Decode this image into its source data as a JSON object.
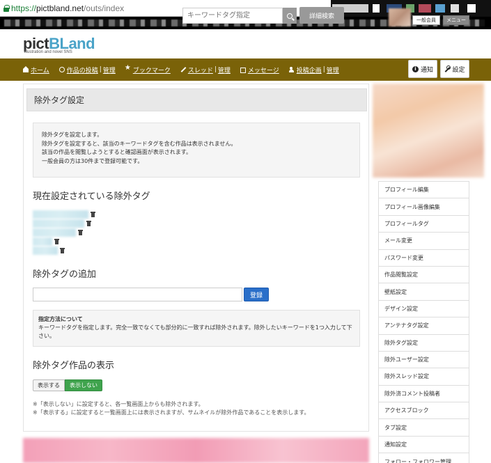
{
  "browser": {
    "url_protocol": "https://",
    "url_host": "pictbland.net",
    "url_path": "/outs/index"
  },
  "header": {
    "logo_pict": "pict",
    "logo_bland": "BLand",
    "logo_sub": "illustration and novel SNS",
    "search_placeholder": "キーワードタグ指定",
    "advanced_search_label": "詳細検索",
    "member_badge": "一般会員",
    "menu_label": "メニュー"
  },
  "nav": {
    "items": [
      {
        "label": "ホーム"
      },
      {
        "label": "作品の投稿",
        "extra": "管理"
      },
      {
        "label": "ブックマーク"
      },
      {
        "label": "スレッド",
        "extra": "管理"
      },
      {
        "label": "メッセージ"
      },
      {
        "label": "投稿企画",
        "extra": "管理"
      }
    ],
    "notification_label": "通知",
    "settings_label": "設定"
  },
  "main": {
    "title": "除外タグ設定",
    "info_lines": [
      "除外タグを設定します。",
      "除外タグを設定すると、該当のキーワードタグを含む作品は表示されません。",
      "該当の作品を閲覧しようとすると確認画面が表示されます。",
      "一般会員の方は30件まで登録可能です。"
    ],
    "current_tags_heading": "現在設定されている除外タグ",
    "add_heading": "除外タグの追加",
    "register_label": "登録",
    "spec_title": "指定方法について",
    "spec_text": "キーワードタグを指定します。完全一致でなくても部分的に一致すれば除外されます。除外したいキーワードを1つ入力して下さい。",
    "display_heading": "除外タグ作品の表示",
    "toggle_show": "表示する",
    "toggle_hide": "表示しない",
    "toggle_selected": "表示しない",
    "notes": [
      "※「表示しない」に設定すると、各一覧画面上からも除外されます。",
      "※「表示する」に設定すると一覧画面上には表示されますが、サムネイルが除外作品であることを表示します。"
    ]
  },
  "sidebar": {
    "items": [
      "プロフィール編集",
      "プロフィール画像編集",
      "プロフィールタグ",
      "メール変更",
      "パスワード変更",
      "作品閲覧設定",
      "壁紙設定",
      "デザイン設定",
      "アンテナタグ設定",
      "除外タグ設定",
      "除外ユーザー設定",
      "除外スレッド設定",
      "除外済コメント投稿者",
      "アクセスブロック",
      "タブ設定",
      "通知設定",
      "フォロー・フォロワー管理"
    ]
  }
}
